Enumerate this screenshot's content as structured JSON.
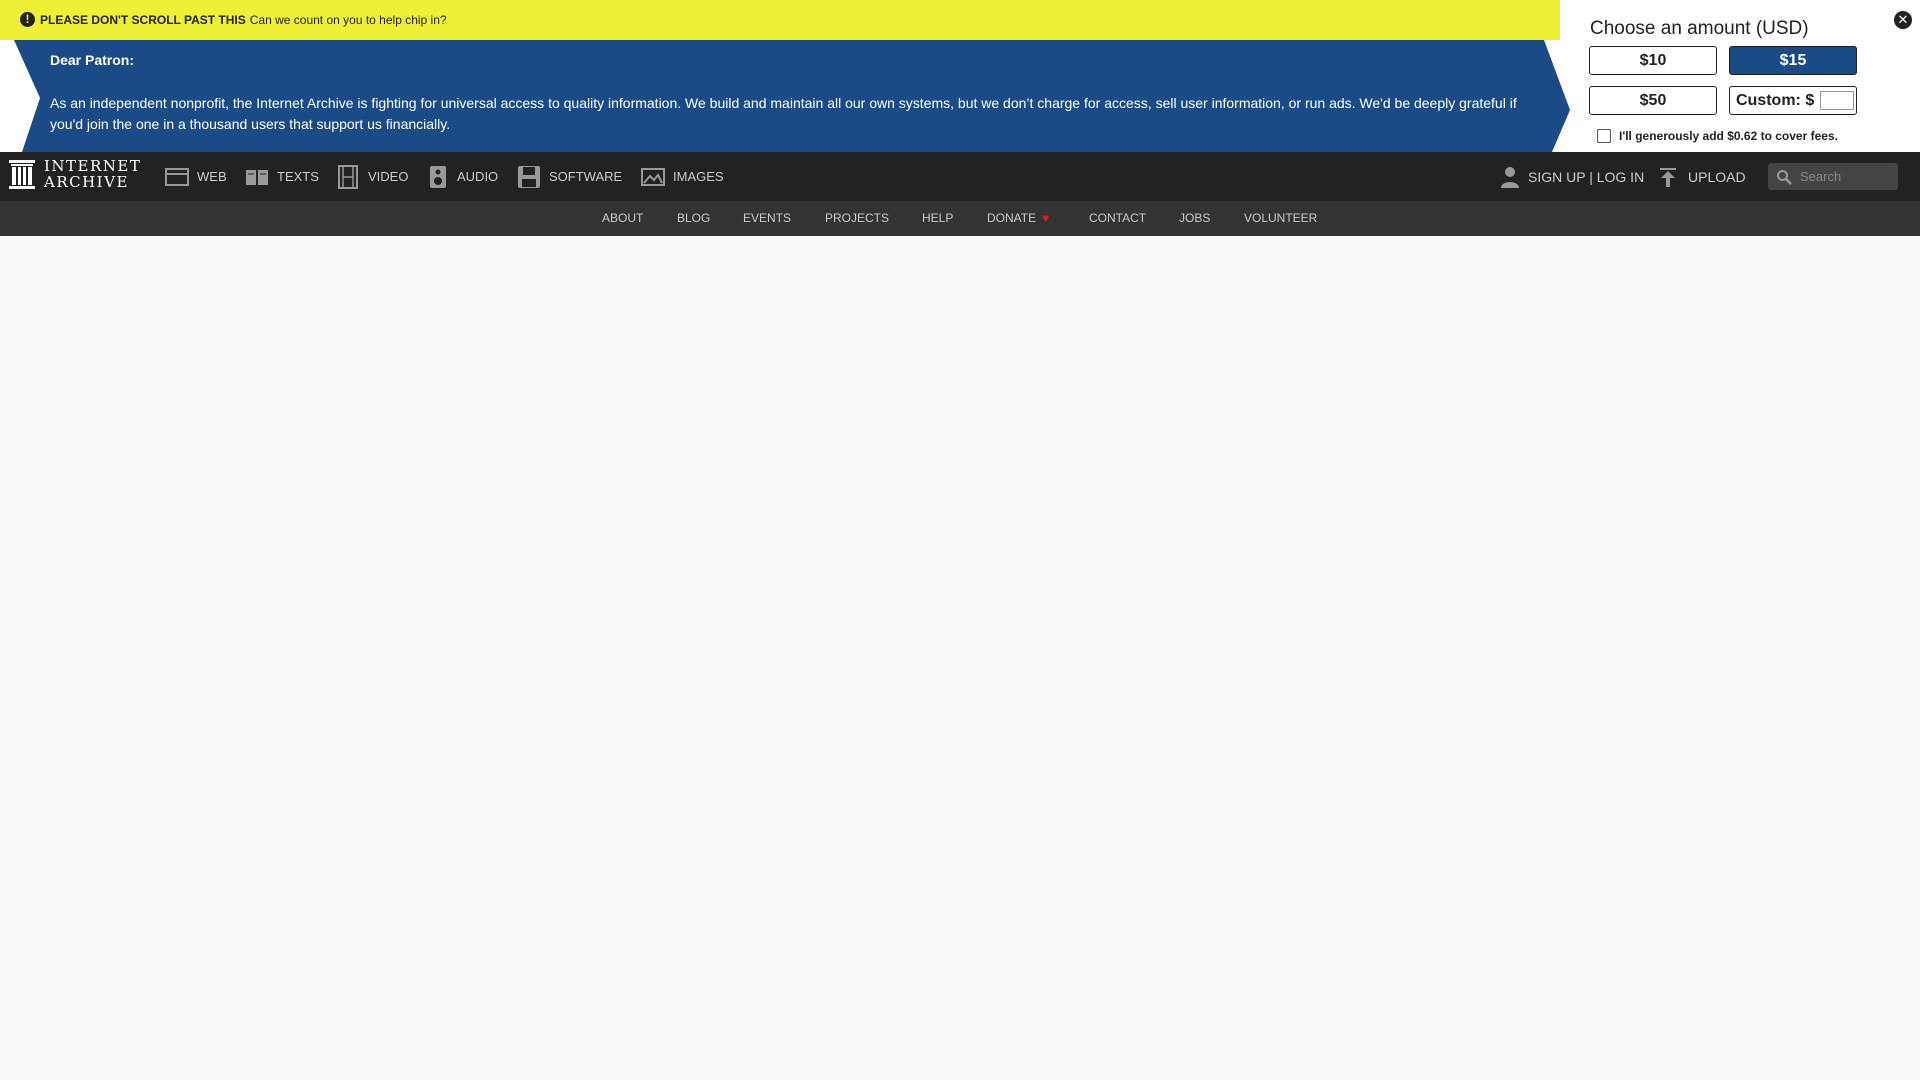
{
  "banner": {
    "alert_strong": "PLEASE DON'T SCROLL PAST THIS",
    "alert_text": "Can we count on you to help chip in?",
    "greeting": "Dear Patron:",
    "appeal": "As an independent nonprofit, the Internet Archive is fighting for universal access to quality information. We build and maintain all our own systems, but we don’t charge for access, sell user information, or run ads. We'd be deeply grateful if you'd join the one in a thousand users that support us financially.",
    "donate_title": "Choose an amount (USD)",
    "amounts": [
      "$10",
      "$15",
      "$50"
    ],
    "selected_amount": "$15",
    "custom_label": "Custom: $",
    "custom_value": "",
    "fees_label": "I'll generously add $0.62 to cover fees.",
    "colors": {
      "yellow": "#eef036",
      "blue": "#1b4b87"
    }
  },
  "topnav": {
    "logo_line1": "INTERNET",
    "logo_line2": "ARCHIVE",
    "media": [
      "WEB",
      "TEXTS",
      "VIDEO",
      "AUDIO",
      "SOFTWARE",
      "IMAGES"
    ],
    "account": "SIGN UP | LOG IN",
    "upload": "UPLOAD",
    "search_placeholder": "Search"
  },
  "subnav": {
    "items": [
      "ABOUT",
      "BLOG",
      "EVENTS",
      "PROJECTS",
      "HELP",
      "DONATE",
      "CONTACT",
      "JOBS",
      "VOLUNTEER"
    ]
  }
}
